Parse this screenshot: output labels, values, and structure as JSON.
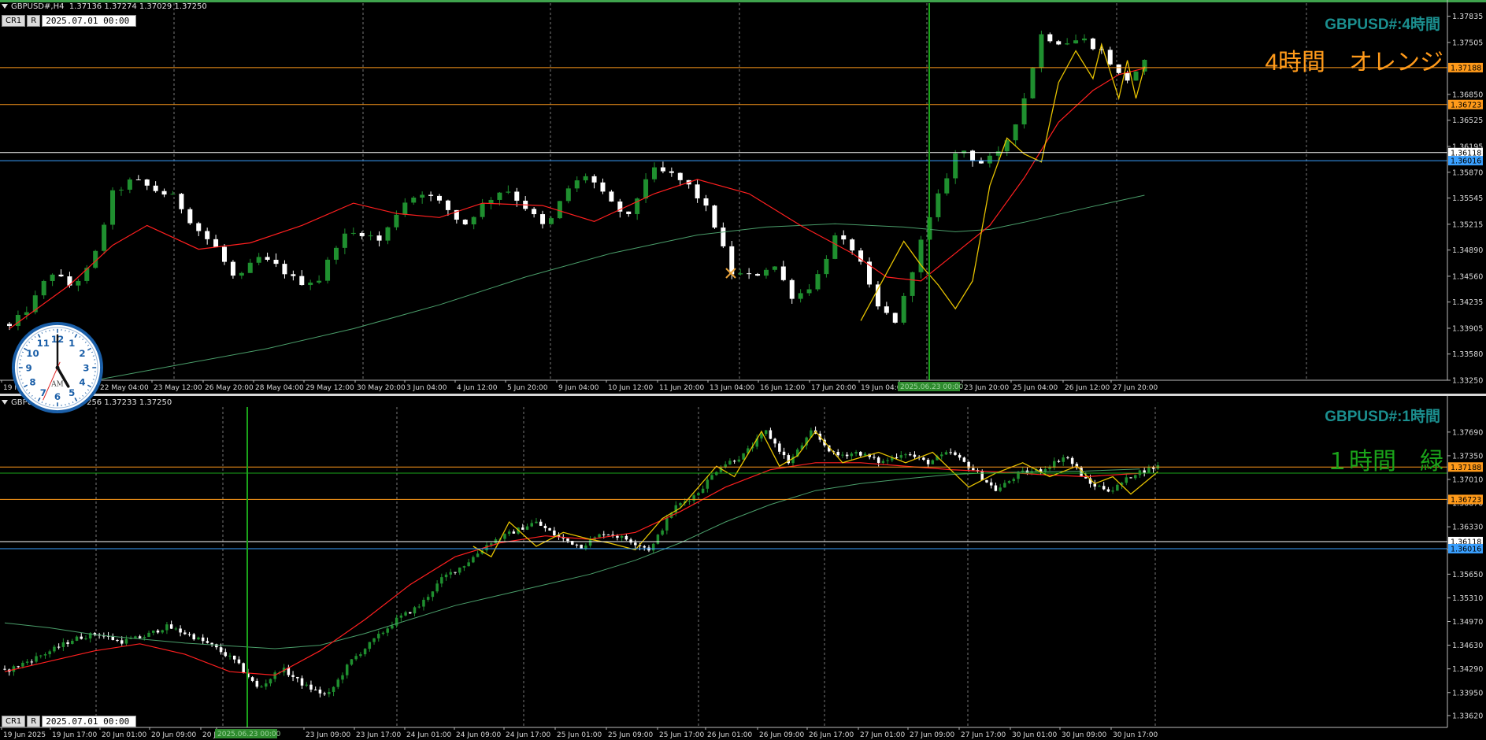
{
  "colors": {
    "bull": "#1f8f2f",
    "bear": "#ffffff",
    "ma_fast": "#ff1f1f",
    "ma_slow": "#4a9e6a",
    "zigzag": "#e6c200",
    "level_orange": "#ff9a1a",
    "level_white": "#ffffff",
    "level_blue": "#3aa0ff",
    "cursor_line": "#1aa31a",
    "grid": "#777777",
    "axis_text": "#d8d8d8",
    "title_teal": "#1b8f8f"
  },
  "toolbar": {
    "cr1_label": "CR1",
    "r_label": "R",
    "date_value": "2025.07.01 00:00"
  },
  "chart_data": [
    {
      "type": "candlestick",
      "symbol": "GBPUSD#",
      "timeframe": "H4",
      "header_label": "GBPUSD#,H4",
      "ohlc_text": "1.37136 1.37274 1.37029 1.37250",
      "title": "GBPUSD#:4時間",
      "note": "4時間　オレンジ",
      "note_color": "#ff9a1a",
      "ylim": [
        1.3325,
        1.38
      ],
      "y_ticks": [
        "1.37835",
        "1.37505",
        "1.37188",
        "1.36850",
        "1.36723",
        "1.36525",
        "1.36195",
        "1.36118",
        "1.36016",
        "1.35870",
        "1.35545",
        "1.35215",
        "1.34890",
        "1.34560",
        "1.34235",
        "1.33905",
        "1.33580",
        "1.33250"
      ],
      "x_ticks": [
        "19 May 2025",
        "22 May 04:00",
        "23 May 12:00",
        "26 May 20:00",
        "28 May 04:00",
        "29 May 12:00",
        "30 May 20:00",
        "3 Jun 04:00",
        "4 Jun 12:00",
        "5 Jun 20:00",
        "9 Jun 04:00",
        "10 Jun 12:00",
        "11 Jun 20:00",
        "13 Jun 04:00",
        "16 Jun 12:00",
        "17 Jun 20:00",
        "19 Jun 04:00",
        "2025.06.23 00:00",
        "23 Jun 20:00",
        "25 Jun 04:00",
        "26 Jun 12:00",
        "27 Jun 20:00"
      ],
      "cursor_label": "2025.06.23 00:00",
      "levels": [
        {
          "price": 1.37188,
          "label": "1.37188",
          "kind": "orange"
        },
        {
          "price": 1.36723,
          "label": "1.36723",
          "kind": "orange"
        },
        {
          "price": 1.36118,
          "label": "1.36118",
          "kind": "white"
        },
        {
          "price": 1.36016,
          "label": "1.36016",
          "kind": "blue"
        }
      ],
      "anchors": [
        1.3392,
        1.3418,
        1.3462,
        1.3443,
        1.347,
        1.356,
        1.3578,
        1.3565,
        1.3555,
        1.3518,
        1.3492,
        1.3448,
        1.348,
        1.3468,
        1.3448,
        1.3452,
        1.3505,
        1.3512,
        1.35,
        1.3548,
        1.3562,
        1.3546,
        1.352,
        1.3548,
        1.3568,
        1.3543,
        1.3515,
        1.3565,
        1.3585,
        1.355,
        1.353,
        1.359,
        1.3585,
        1.3568,
        1.3532,
        1.346,
        1.3455,
        1.3472,
        1.3428,
        1.3448,
        1.3505,
        1.3488,
        1.3418,
        1.3398,
        1.3488,
        1.3556,
        1.362,
        1.3598,
        1.361,
        1.3665,
        1.376,
        1.375,
        1.3755,
        1.3738,
        1.37,
        1.3725
      ],
      "ma_fast": [
        [
          0,
          1.339
        ],
        [
          7,
          1.3445
        ],
        [
          12,
          1.3495
        ],
        [
          16,
          1.352
        ],
        [
          22,
          1.349
        ],
        [
          28,
          1.3498
        ],
        [
          34,
          1.352
        ],
        [
          40,
          1.3548
        ],
        [
          45,
          1.3535
        ],
        [
          50,
          1.353
        ],
        [
          55,
          1.3548
        ],
        [
          62,
          1.3545
        ],
        [
          68,
          1.3525
        ],
        [
          75,
          1.356
        ],
        [
          80,
          1.3578
        ],
        [
          86,
          1.356
        ],
        [
          92,
          1.352
        ],
        [
          98,
          1.3485
        ],
        [
          102,
          1.3455
        ],
        [
          106,
          1.345
        ],
        [
          110,
          1.3485
        ],
        [
          114,
          1.352
        ],
        [
          118,
          1.358
        ],
        [
          122,
          1.365
        ],
        [
          126,
          1.369
        ],
        [
          129,
          1.371
        ],
        [
          132,
          1.3718
        ]
      ],
      "ma_slow": [
        [
          0,
          1.33
        ],
        [
          10,
          1.3325
        ],
        [
          20,
          1.3345
        ],
        [
          30,
          1.3365
        ],
        [
          40,
          1.339
        ],
        [
          50,
          1.342
        ],
        [
          60,
          1.3455
        ],
        [
          70,
          1.3485
        ],
        [
          80,
          1.3508
        ],
        [
          88,
          1.3518
        ],
        [
          96,
          1.3522
        ],
        [
          104,
          1.3518
        ],
        [
          110,
          1.3512
        ],
        [
          114,
          1.3515
        ],
        [
          118,
          1.3524
        ],
        [
          122,
          1.3534
        ],
        [
          126,
          1.3544
        ],
        [
          132,
          1.3558
        ]
      ],
      "zigzag": [
        [
          99,
          1.34
        ],
        [
          104,
          1.35
        ],
        [
          106,
          1.347
        ],
        [
          108,
          1.3445
        ],
        [
          110,
          1.3415
        ],
        [
          112,
          1.345
        ],
        [
          114,
          1.357
        ],
        [
          116,
          1.363
        ],
        [
          118,
          1.361
        ],
        [
          120,
          1.36
        ],
        [
          122,
          1.37
        ],
        [
          124,
          1.374
        ],
        [
          126,
          1.3705
        ],
        [
          127,
          1.3748
        ],
        [
          129,
          1.368
        ],
        [
          130,
          1.3728
        ],
        [
          131,
          1.368
        ],
        [
          132,
          1.372
        ]
      ]
    },
    {
      "type": "candlestick",
      "symbol": "GBPUSD#",
      "timeframe": "H1",
      "header_label": "GBPUSD#,H1",
      "ohlc_text": "1.37256 1.37233 1.37250",
      "title": "GBPUSD#:1時間",
      "note": "１時間　緑",
      "note_color": "#1aa31a",
      "ylim": [
        1.3345,
        1.3805
      ],
      "y_ticks": [
        "1.37690",
        "1.37350",
        "1.37188",
        "1.37010",
        "1.36723",
        "1.36670",
        "1.36330",
        "1.36118",
        "1.36000",
        "1.35650",
        "1.35310",
        "1.34970",
        "1.34630",
        "1.34290",
        "1.33950",
        "1.33620"
      ],
      "x_ticks": [
        "19 Jun 2025",
        "19 Jun 17:00",
        "20 Jun 01:00",
        "20 Jun 09:00",
        "20 Jun 17:00",
        "2025.06.23 00:00",
        "23 Jun 09:00",
        "23 Jun 17:00",
        "24 Jun 01:00",
        "24 Jun 09:00",
        "24 Jun 17:00",
        "25 Jun 01:00",
        "25 Jun 09:00",
        "25 Jun 17:00",
        "26 Jun 01:00",
        "26 Jun 09:00",
        "26 Jun 17:00",
        "27 Jun 01:00",
        "27 Jun 09:00",
        "27 Jun 17:00",
        "30 Jun 01:00",
        "30 Jun 09:00",
        "30 Jun 17:00"
      ],
      "cursor_label": "2025.06.23 00:00",
      "levels": [
        {
          "price": 1.37188,
          "label": "1.37188",
          "kind": "orange"
        },
        {
          "price": 1.371,
          "label": "",
          "kind": "green"
        },
        {
          "price": 1.36723,
          "label": "1.36723",
          "kind": "orange"
        },
        {
          "price": 1.36118,
          "label": "1.36118",
          "kind": "white"
        },
        {
          "price": 1.36016,
          "label": "1.36016",
          "kind": "blue"
        }
      ],
      "anchors": [
        1.3425,
        1.344,
        1.3455,
        1.3472,
        1.348,
        1.3468,
        1.3475,
        1.349,
        1.3478,
        1.3462,
        1.344,
        1.34,
        1.343,
        1.3405,
        1.339,
        1.344,
        1.347,
        1.35,
        1.352,
        1.356,
        1.358,
        1.361,
        1.3625,
        1.364,
        1.3618,
        1.3605,
        1.3625,
        1.3615,
        1.36,
        1.366,
        1.368,
        1.372,
        1.3735,
        1.377,
        1.3725,
        1.377,
        1.3735,
        1.374,
        1.3725,
        1.374,
        1.3725,
        1.374,
        1.3715,
        1.3685,
        1.371,
        1.3715,
        1.3735,
        1.3695,
        1.3685,
        1.371,
        1.372
      ],
      "ma_fast": [
        [
          0,
          1.3425
        ],
        [
          10,
          1.344
        ],
        [
          20,
          1.3455
        ],
        [
          30,
          1.3465
        ],
        [
          40,
          1.345
        ],
        [
          50,
          1.3425
        ],
        [
          60,
          1.342
        ],
        [
          70,
          1.3455
        ],
        [
          80,
          1.35
        ],
        [
          90,
          1.355
        ],
        [
          100,
          1.359
        ],
        [
          110,
          1.361
        ],
        [
          120,
          1.362
        ],
        [
          130,
          1.3615
        ],
        [
          140,
          1.3625
        ],
        [
          150,
          1.3655
        ],
        [
          160,
          1.369
        ],
        [
          170,
          1.3715
        ],
        [
          180,
          1.3725
        ],
        [
          190,
          1.3725
        ],
        [
          200,
          1.372
        ],
        [
          210,
          1.3715
        ],
        [
          220,
          1.3712
        ],
        [
          230,
          1.3708
        ],
        [
          240,
          1.3705
        ],
        [
          252,
          1.371
        ]
      ],
      "ma_slow": [
        [
          0,
          1.3495
        ],
        [
          10,
          1.3488
        ],
        [
          20,
          1.3478
        ],
        [
          30,
          1.3472
        ],
        [
          40,
          1.3466
        ],
        [
          50,
          1.3462
        ],
        [
          60,
          1.3458
        ],
        [
          70,
          1.3463
        ],
        [
          80,
          1.348
        ],
        [
          90,
          1.35
        ],
        [
          100,
          1.352
        ],
        [
          110,
          1.3535
        ],
        [
          120,
          1.355
        ],
        [
          130,
          1.3565
        ],
        [
          140,
          1.3585
        ],
        [
          150,
          1.361
        ],
        [
          160,
          1.364
        ],
        [
          170,
          1.3665
        ],
        [
          180,
          1.3685
        ],
        [
          190,
          1.3695
        ],
        [
          200,
          1.3702
        ],
        [
          210,
          1.3708
        ],
        [
          220,
          1.3711
        ],
        [
          230,
          1.3712
        ],
        [
          240,
          1.3713
        ],
        [
          252,
          1.3716
        ]
      ],
      "zigzag": [
        [
          104,
          1.3605
        ],
        [
          108,
          1.359
        ],
        [
          112,
          1.364
        ],
        [
          118,
          1.3605
        ],
        [
          124,
          1.3625
        ],
        [
          130,
          1.3615
        ],
        [
          134,
          1.361
        ],
        [
          140,
          1.36
        ],
        [
          146,
          1.3645
        ],
        [
          150,
          1.366
        ],
        [
          158,
          1.372
        ],
        [
          162,
          1.3705
        ],
        [
          168,
          1.377
        ],
        [
          172,
          1.372
        ],
        [
          176,
          1.3735
        ],
        [
          180,
          1.377
        ],
        [
          186,
          1.3725
        ],
        [
          194,
          1.374
        ],
        [
          200,
          1.3725
        ],
        [
          206,
          1.374
        ],
        [
          214,
          1.369
        ],
        [
          220,
          1.371
        ],
        [
          226,
          1.3725
        ],
        [
          232,
          1.3705
        ],
        [
          238,
          1.372
        ],
        [
          242,
          1.3695
        ],
        [
          246,
          1.3705
        ],
        [
          250,
          1.368
        ],
        [
          256,
          1.3712
        ]
      ]
    }
  ],
  "clock": {
    "am_label": "AM",
    "numbers": [
      "12",
      "1",
      "2",
      "3",
      "4",
      "5",
      "6",
      "7",
      "8",
      "9",
      "10",
      "11"
    ],
    "hour": 5,
    "minute": 0,
    "second": 34
  }
}
